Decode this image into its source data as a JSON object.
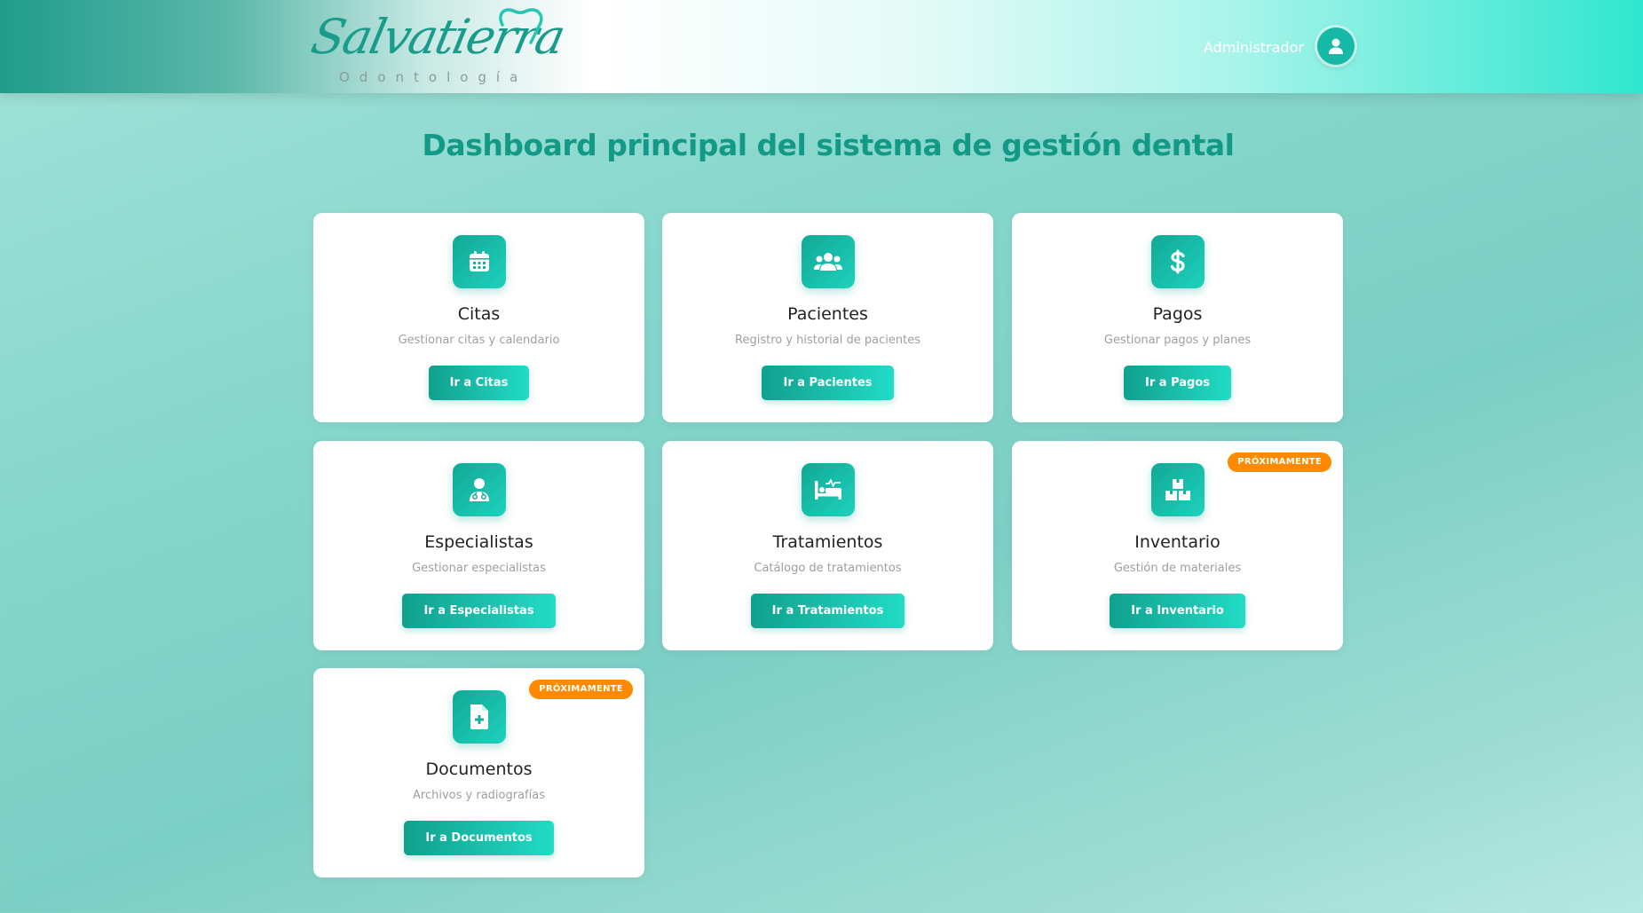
{
  "header": {
    "logo": {
      "script": "Salvatierra",
      "subtitle": "Odontología"
    },
    "user": {
      "name": "Administrador",
      "avatar_icon": "user-icon"
    }
  },
  "main": {
    "title": "Dashboard principal del sistema de gestión dental",
    "cards": [
      {
        "icon": "calendar-icon",
        "title": "Citas",
        "description": "Gestionar citas y calendario",
        "button": "Ir a Citas"
      },
      {
        "icon": "users-icon",
        "title": "Pacientes",
        "description": "Registro y historial de pacientes",
        "button": "Ir a Pacientes"
      },
      {
        "icon": "dollar-icon",
        "title": "Pagos",
        "description": "Gestionar pagos y planes",
        "button": "Ir a Pagos"
      },
      {
        "icon": "doctor-icon",
        "title": "Especialistas",
        "description": "Gestionar especialistas",
        "button": "Ir a Especialistas"
      },
      {
        "icon": "bed-pulse-icon",
        "title": "Tratamientos",
        "description": "Catálogo de tratamientos",
        "button": "Ir a Tratamientos"
      },
      {
        "icon": "boxes-icon",
        "title": "Inventario",
        "description": "Gestión de materiales",
        "button": "Ir a Inventario",
        "badge": "PRÓXIMAMENTE"
      },
      {
        "icon": "file-medical-icon",
        "title": "Documentos",
        "description": "Archivos y radiografías",
        "button": "Ir a Documentos",
        "badge": "PRÓXIMAMENTE"
      }
    ]
  },
  "colors": {
    "accent": "#129a86",
    "button_start": "#11a08e",
    "button_end": "#21dcc6",
    "badge": "#ff8a00"
  }
}
